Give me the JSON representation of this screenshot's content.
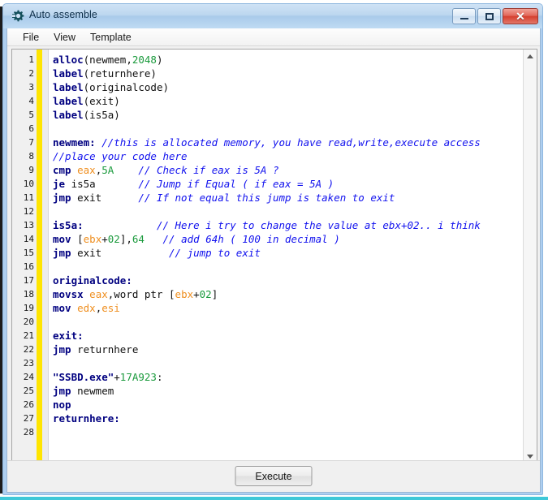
{
  "window": {
    "title": "Auto assemble",
    "icon": "cog-icon",
    "controls": {
      "minimize": "minimize-button",
      "maximize": "maximize-button",
      "close_label": "✕"
    }
  },
  "menu": {
    "items": [
      {
        "label": "File"
      },
      {
        "label": "View"
      },
      {
        "label": "Template"
      }
    ]
  },
  "editor": {
    "line_count": 28,
    "line_numbers": [
      "1",
      "2",
      "3",
      "4",
      "5",
      "6",
      "7",
      "8",
      "9",
      "10",
      "11",
      "12",
      "13",
      "14",
      "15",
      "16",
      "17",
      "18",
      "19",
      "20",
      "21",
      "22",
      "23",
      "24",
      "25",
      "26",
      "27",
      "28"
    ],
    "colors": {
      "keyword": "#000080",
      "register": "#ef8f20",
      "number": "#1a9a3c",
      "comment": "#1111ee",
      "plain": "#101010",
      "gutter_marker": "#ffe500",
      "background": "#ffffff"
    },
    "lines": [
      {
        "n": 1,
        "tokens": [
          {
            "t": "kw",
            "v": "alloc"
          },
          {
            "t": "plain",
            "v": "(newmem,"
          },
          {
            "t": "num",
            "v": "2048"
          },
          {
            "t": "plain",
            "v": ")"
          }
        ]
      },
      {
        "n": 2,
        "tokens": [
          {
            "t": "kw",
            "v": "label"
          },
          {
            "t": "plain",
            "v": "(returnhere)"
          }
        ]
      },
      {
        "n": 3,
        "tokens": [
          {
            "t": "kw",
            "v": "label"
          },
          {
            "t": "plain",
            "v": "(originalcode)"
          }
        ]
      },
      {
        "n": 4,
        "tokens": [
          {
            "t": "kw",
            "v": "label"
          },
          {
            "t": "plain",
            "v": "(exit)"
          }
        ]
      },
      {
        "n": 5,
        "tokens": [
          {
            "t": "kw",
            "v": "label"
          },
          {
            "t": "plain",
            "v": "(is5a)"
          }
        ]
      },
      {
        "n": 6,
        "tokens": []
      },
      {
        "n": 7,
        "tokens": [
          {
            "t": "kw",
            "v": "newmem:"
          },
          {
            "t": "plain",
            "v": " "
          },
          {
            "t": "com",
            "v": "//this is allocated memory, you have read,write,execute access"
          }
        ]
      },
      {
        "n": 8,
        "tokens": [
          {
            "t": "com",
            "v": "//place your code here"
          }
        ]
      },
      {
        "n": 9,
        "tokens": [
          {
            "t": "kw",
            "v": "cmp"
          },
          {
            "t": "plain",
            "v": " "
          },
          {
            "t": "reg",
            "v": "eax"
          },
          {
            "t": "plain",
            "v": ","
          },
          {
            "t": "num",
            "v": "5A"
          },
          {
            "t": "plain",
            "v": "    "
          },
          {
            "t": "com",
            "v": "// Check if eax is 5A ?"
          }
        ]
      },
      {
        "n": 10,
        "tokens": [
          {
            "t": "kw",
            "v": "je"
          },
          {
            "t": "plain",
            "v": " is5a"
          },
          {
            "t": "plain",
            "v": "       "
          },
          {
            "t": "com",
            "v": "// Jump if Equal ( if eax = 5A )"
          }
        ]
      },
      {
        "n": 11,
        "tokens": [
          {
            "t": "kw",
            "v": "jmp"
          },
          {
            "t": "plain",
            "v": " exit"
          },
          {
            "t": "plain",
            "v": "      "
          },
          {
            "t": "com",
            "v": "// If not equal this jump is taken to exit"
          }
        ]
      },
      {
        "n": 12,
        "tokens": []
      },
      {
        "n": 13,
        "tokens": [
          {
            "t": "kw",
            "v": "is5a:"
          },
          {
            "t": "plain",
            "v": "            "
          },
          {
            "t": "com",
            "v": "// Here i try to change the value at ebx+02.. i think"
          }
        ]
      },
      {
        "n": 14,
        "tokens": [
          {
            "t": "kw",
            "v": "mov"
          },
          {
            "t": "plain",
            "v": " ["
          },
          {
            "t": "reg",
            "v": "ebx"
          },
          {
            "t": "plain",
            "v": "+"
          },
          {
            "t": "num",
            "v": "02"
          },
          {
            "t": "plain",
            "v": "],"
          },
          {
            "t": "num",
            "v": "64"
          },
          {
            "t": "plain",
            "v": "   "
          },
          {
            "t": "com",
            "v": "// add 64h ( 100 in decimal )"
          }
        ]
      },
      {
        "n": 15,
        "tokens": [
          {
            "t": "kw",
            "v": "jmp"
          },
          {
            "t": "plain",
            "v": " exit"
          },
          {
            "t": "plain",
            "v": "           "
          },
          {
            "t": "com",
            "v": "// jump to exit"
          }
        ]
      },
      {
        "n": 16,
        "tokens": []
      },
      {
        "n": 17,
        "tokens": [
          {
            "t": "kw",
            "v": "originalcode:"
          }
        ]
      },
      {
        "n": 18,
        "tokens": [
          {
            "t": "kw",
            "v": "movsx"
          },
          {
            "t": "plain",
            "v": " "
          },
          {
            "t": "reg",
            "v": "eax"
          },
          {
            "t": "plain",
            "v": ",word ptr ["
          },
          {
            "t": "reg",
            "v": "ebx"
          },
          {
            "t": "plain",
            "v": "+"
          },
          {
            "t": "num",
            "v": "02"
          },
          {
            "t": "plain",
            "v": "]"
          }
        ]
      },
      {
        "n": 19,
        "tokens": [
          {
            "t": "kw",
            "v": "mov"
          },
          {
            "t": "plain",
            "v": " "
          },
          {
            "t": "reg",
            "v": "edx"
          },
          {
            "t": "plain",
            "v": ","
          },
          {
            "t": "reg",
            "v": "esi"
          }
        ]
      },
      {
        "n": 20,
        "tokens": []
      },
      {
        "n": 21,
        "tokens": [
          {
            "t": "kw",
            "v": "exit:"
          }
        ]
      },
      {
        "n": 22,
        "tokens": [
          {
            "t": "kw",
            "v": "jmp"
          },
          {
            "t": "plain",
            "v": " returnhere"
          }
        ]
      },
      {
        "n": 23,
        "tokens": []
      },
      {
        "n": 24,
        "tokens": [
          {
            "t": "kw",
            "v": "\"SSBD.exe\""
          },
          {
            "t": "plain",
            "v": "+"
          },
          {
            "t": "num",
            "v": "17A923"
          },
          {
            "t": "plain",
            "v": ":"
          }
        ]
      },
      {
        "n": 25,
        "tokens": [
          {
            "t": "kw",
            "v": "jmp"
          },
          {
            "t": "plain",
            "v": " newmem"
          }
        ]
      },
      {
        "n": 26,
        "tokens": [
          {
            "t": "kw",
            "v": "nop"
          }
        ]
      },
      {
        "n": 27,
        "tokens": [
          {
            "t": "kw",
            "v": "returnhere:"
          }
        ]
      },
      {
        "n": 28,
        "tokens": []
      }
    ]
  },
  "scrollbars": {
    "vertical": {
      "up_arrow": "▲",
      "down_arrow": "▼"
    },
    "horizontal": {
      "left_arrow": "◀",
      "right_arrow": "▶"
    }
  },
  "footer": {
    "execute_label": "Execute"
  }
}
